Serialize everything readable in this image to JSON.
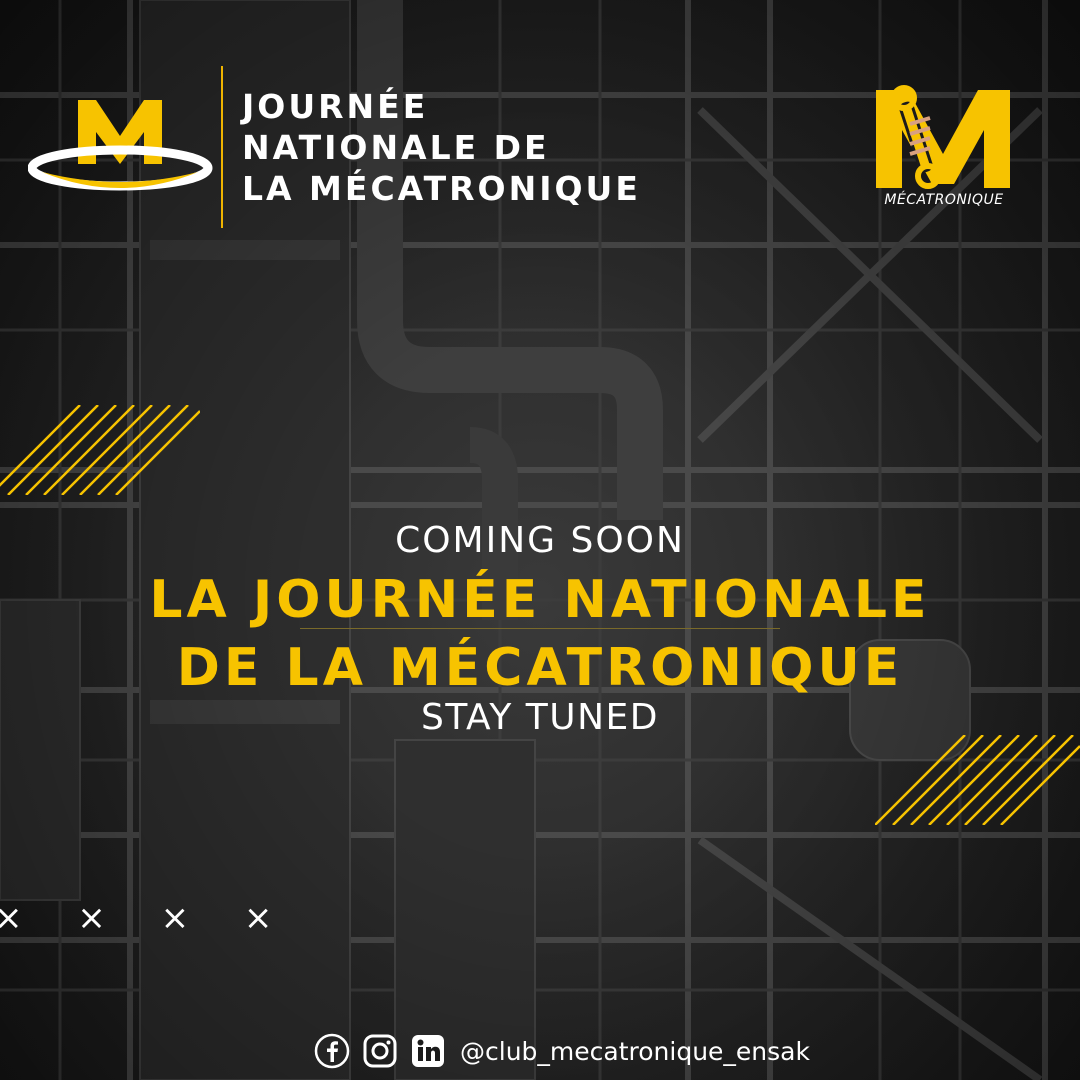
{
  "event": {
    "title_lines": [
      "JOURNÉE",
      "NATIONALE DE",
      "LA MÉCATRONIQUE"
    ]
  },
  "club": {
    "logo_text": "MÉCATRONIQUE"
  },
  "announcement": {
    "kicker": "COMING SOON",
    "headline_line1": "LA JOURNÉE NATIONALE",
    "headline_line2": "DE LA MÉCATRONIQUE",
    "tagline": "STAY TUNED"
  },
  "decor": {
    "x_marks": "× × × ×"
  },
  "footer": {
    "handle": "@club_mecatronique_ensak",
    "icons": [
      "facebook-icon",
      "instagram-icon",
      "linkedin-icon"
    ]
  },
  "colors": {
    "accent": "#f7c300",
    "text": "#ffffff",
    "background": "#262626"
  }
}
